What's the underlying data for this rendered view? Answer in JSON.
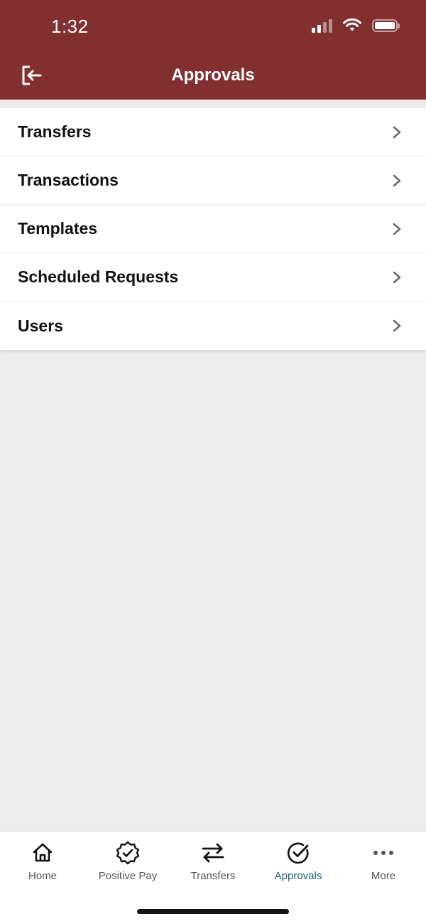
{
  "status_bar": {
    "time": "1:32"
  },
  "header": {
    "title": "Approvals",
    "background": "#812f2f",
    "back_icon": "logout-icon"
  },
  "menu": {
    "items": [
      {
        "label": "Transfers",
        "icon": "chevron-right-icon"
      },
      {
        "label": "Transactions",
        "icon": "chevron-right-icon"
      },
      {
        "label": "Templates",
        "icon": "chevron-right-icon"
      },
      {
        "label": "Scheduled Requests",
        "icon": "chevron-right-icon"
      },
      {
        "label": "Users",
        "icon": "chevron-right-icon"
      }
    ]
  },
  "tabbar": {
    "active_color": "#1d5f7a",
    "tabs": [
      {
        "label": "Home",
        "icon": "home-icon",
        "active": false
      },
      {
        "label": "Positive Pay",
        "icon": "verified-badge-icon",
        "active": false
      },
      {
        "label": "Transfers",
        "icon": "swap-arrows-icon",
        "active": false
      },
      {
        "label": "Approvals",
        "icon": "check-circle-icon",
        "active": true
      },
      {
        "label": "More",
        "icon": "more-dots-icon",
        "active": false
      }
    ]
  }
}
